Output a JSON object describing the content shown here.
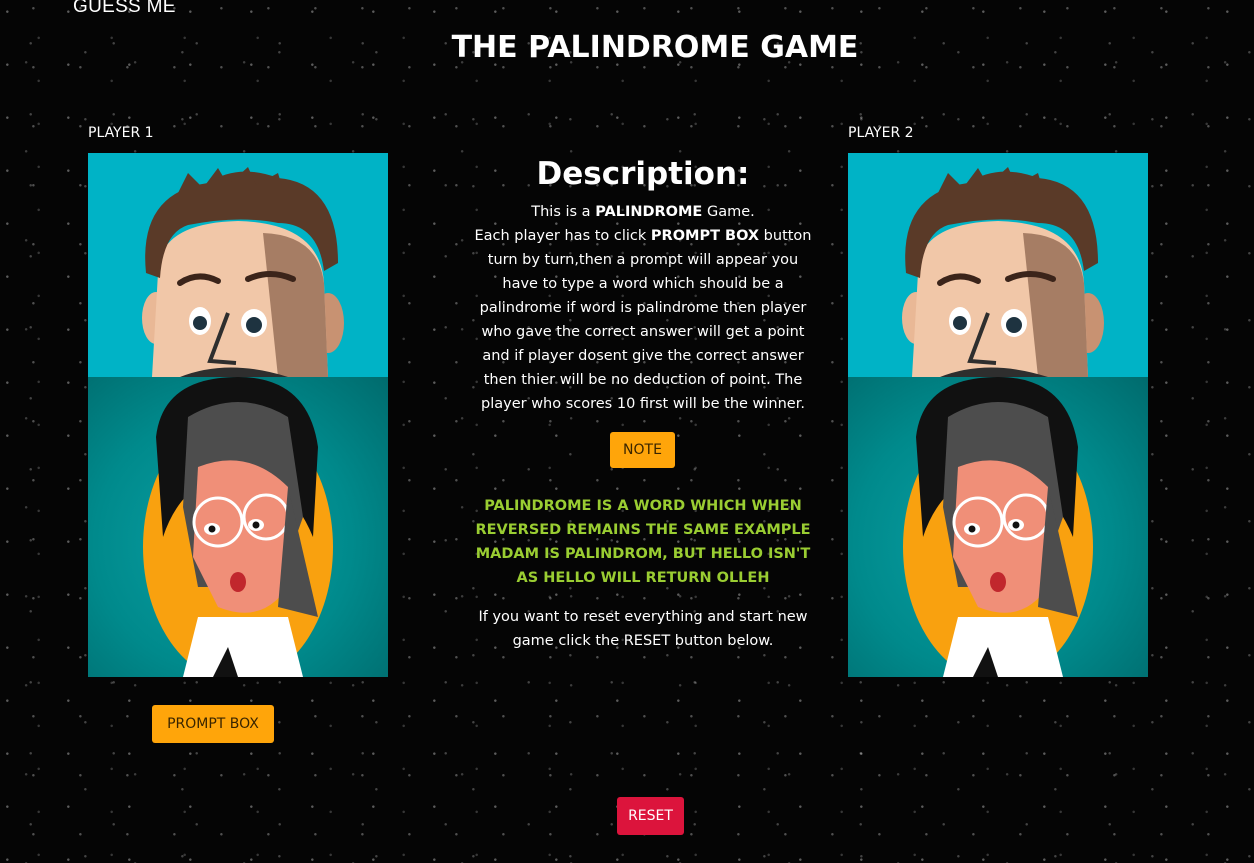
{
  "header": {
    "top_label": "GUESS ME",
    "title": "THE PALINDROME GAME"
  },
  "players": [
    {
      "label": "PLAYER 1",
      "button_label": "PROMPT BOX"
    },
    {
      "label": "PLAYER 2"
    }
  ],
  "description": {
    "title": "Description:",
    "line1_pre": "This is a ",
    "line1_bold": "PALINDROME",
    "line1_post": " Game.",
    "line2_pre": "Each player has to click ",
    "line2_bold": "PROMPT BOX",
    "line2_post": " button turn by turn,then a prompt will appear you have to type a word which should be a palindrome if word is palindrome then player who gave the correct answer will get a point and if player dosent give the correct answer then thier will be no deduction of point. The player who scores 10 first will be the winner."
  },
  "note": {
    "button_label": "NOTE",
    "text": "PALINDROME IS A WORD WHICH WHEN REVERSED REMAINS THE SAME EXAMPLE MADAM IS PALINDROM, BUT HELLO ISN'T AS HELLO WILL RETURN OLLEH"
  },
  "reset": {
    "info": "If you want to reset everything and start new game click the RESET button below.",
    "button_label": "RESET"
  },
  "colors": {
    "accent_orange": "#ffa50a",
    "reset_red": "#dc143c",
    "note_green": "#9acd32",
    "panel_cyan": "#00b3c6",
    "panel_teal": "#008a8c"
  }
}
